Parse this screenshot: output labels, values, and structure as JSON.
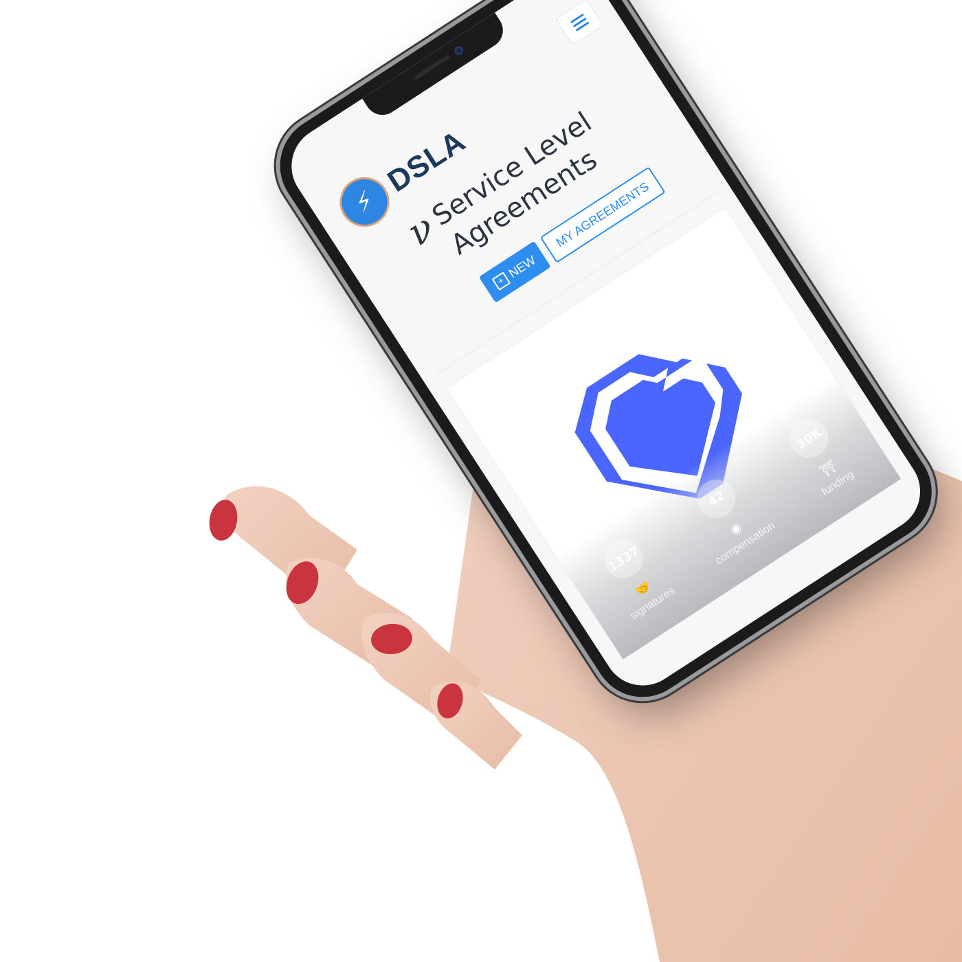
{
  "header": {
    "menu_icon": "hamburger-icon"
  },
  "brand": {
    "logo_icon": "lightning-bolt-icon",
    "name": "DSLA"
  },
  "headline": {
    "line1": "Service Level",
    "line2": "Agreements",
    "glyph": "ν"
  },
  "actions": {
    "new_label": "NEW",
    "my_agreements_label": "MY AGREEMENTS"
  },
  "stats": [
    {
      "value": "1337",
      "icon": "handshake-icon",
      "label": "signatures"
    },
    {
      "value": "42",
      "icon": "coins-stack-icon",
      "label": "compensation"
    },
    {
      "value": "30K",
      "icon": "funding-icon",
      "label": "funding"
    }
  ],
  "colors": {
    "accent": "#2d8ef0",
    "brand_text": "#1c3a5e",
    "logo_mark": "#4b66ff"
  }
}
